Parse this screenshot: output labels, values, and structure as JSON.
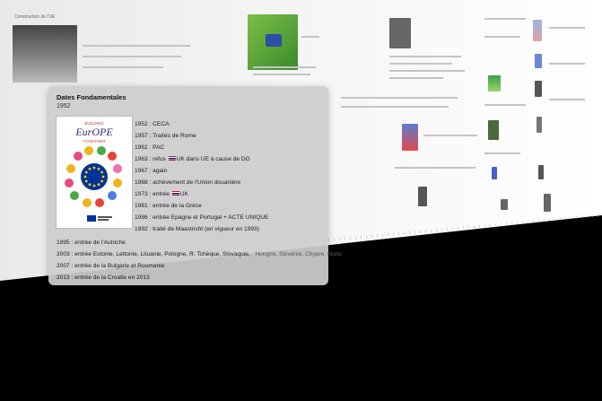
{
  "background": {
    "page_heading": "Construction de l'UE"
  },
  "card": {
    "title": "Dates Fondamentales",
    "subtitle": "1952",
    "poster": {
      "line1": "BUILDING",
      "line2": "EurOPE",
      "line3": "TOGETHER"
    },
    "timeline_top": [
      {
        "year": "1952",
        "text": "CECA"
      },
      {
        "year": "1957",
        "text": "Traités de Rome"
      },
      {
        "year": "1962",
        "text": "PAC"
      },
      {
        "year": "1963",
        "text_before": "refus",
        "flag": "uk-flag-icon",
        "text_after": "UK dans UE à cause de DG"
      },
      {
        "year": "1967",
        "text": "again"
      },
      {
        "year": "1968",
        "text": "achèvement de l'Union douanière"
      },
      {
        "year": "1973",
        "text_before": "entrée",
        "flag": "uk-flag-icon",
        "text_after": "UK"
      },
      {
        "year": "1981",
        "text": "entrée de la Grèce"
      },
      {
        "year": "1986",
        "text": "entrée Epagne et Portugal + ACTE UNIQUE"
      },
      {
        "year": "1992",
        "text": "traité de Maastricht (en vigueur en 1993)"
      }
    ],
    "timeline_bottom": [
      {
        "year": "1995",
        "text": "entrée de l'Autriche"
      },
      {
        "year": "2003",
        "text": "entrée Estonie, Lettonie, Lituanie, Pologne, R. Tchèque, Slovaquie,",
        "text_dim": "Hongrie, Slovénie, Chypre, Malte"
      },
      {
        "year": "2007",
        "text": "entrée de la Bulgarie et Roumanie"
      },
      {
        "year": "2013",
        "text": "entrée de la Croatie en 2013"
      }
    ]
  },
  "colors": {
    "uk_red": "#c8102e",
    "uk_blue": "#012169",
    "eu_blue": "#003399",
    "eu_star": "#ffcc00"
  }
}
